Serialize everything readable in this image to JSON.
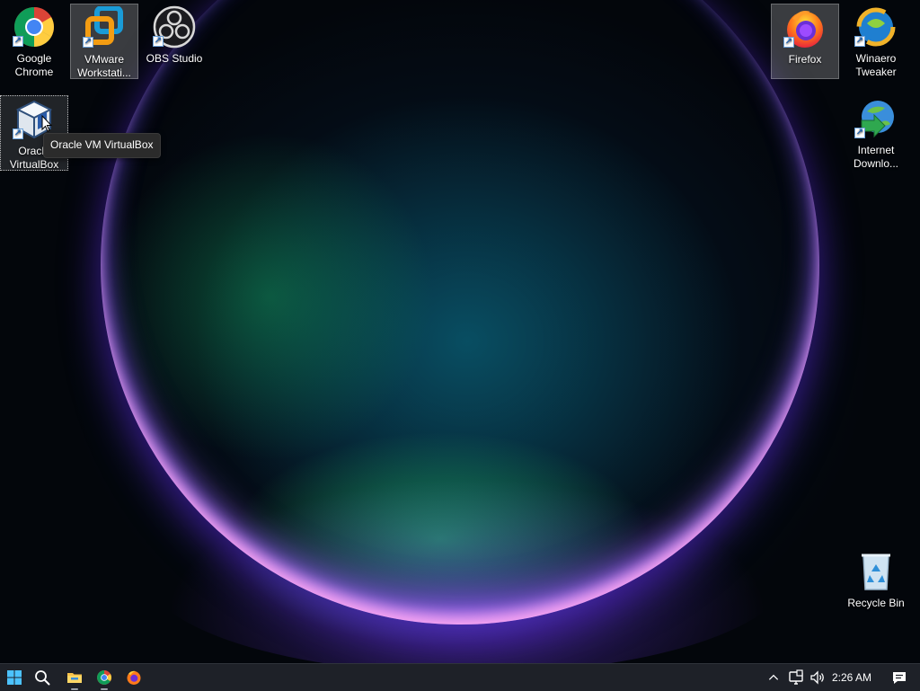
{
  "desktop": {
    "icons": [
      {
        "name": "google-chrome",
        "label": "Google\nChrome"
      },
      {
        "name": "vmware-workstation",
        "label": "VMware\nWorkstati..."
      },
      {
        "name": "obs-studio",
        "label": "OBS Studio"
      },
      {
        "name": "firefox",
        "label": "Firefox"
      },
      {
        "name": "winaero-tweaker",
        "label": "Winaero\nTweaker"
      },
      {
        "name": "oracle-virtualbox",
        "label": "Oracle\nVirtualBox"
      },
      {
        "name": "internet-download-manager",
        "label": "Internet\nDownlo..."
      },
      {
        "name": "recycle-bin",
        "label": "Recycle Bin"
      }
    ],
    "tooltip": "Oracle VM VirtualBox"
  },
  "taskbar": {
    "start": "start-icon",
    "search": "search-icon",
    "pinned": [
      "file-explorer-icon",
      "chrome-icon",
      "firefox-icon"
    ],
    "tray": [
      "chevron-up-icon",
      "network-icon",
      "volume-icon"
    ],
    "clock": "2:26 AM",
    "notifications": "notification-icon"
  },
  "colors": {
    "taskbar_bg": "#1e2128",
    "start_blue": "#4cc2ff",
    "tooltip_bg": "#2b2b2b"
  }
}
